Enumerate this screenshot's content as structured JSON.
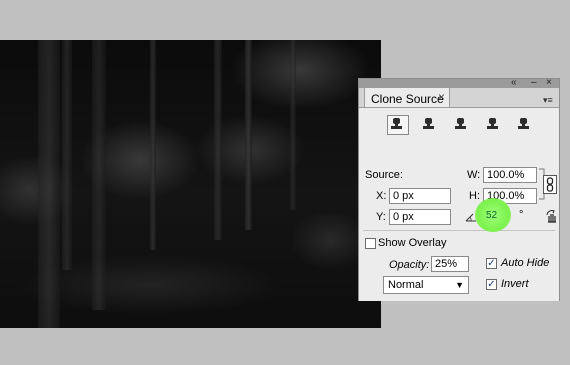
{
  "panel": {
    "tab_title": "Clone Source",
    "close_glyph": "×",
    "collapse_glyph": "«",
    "window_close_glyph": "×",
    "minimize_glyph": "–",
    "menu_glyph": "▾≡"
  },
  "source_buttons": [
    {
      "icon": "clone-source-icon",
      "active": true
    },
    {
      "icon": "clone-source-icon",
      "active": false
    },
    {
      "icon": "clone-source-icon",
      "active": false
    },
    {
      "icon": "clone-source-icon",
      "active": false
    },
    {
      "icon": "clone-source-icon",
      "active": false
    }
  ],
  "source": {
    "label": "Source:",
    "x_label": "X:",
    "x_value": "0 px",
    "y_label": "Y:",
    "y_value": "0 px",
    "w_label": "W:",
    "w_value": "100.0%",
    "h_label": "H:",
    "h_value": "100.0%",
    "rotation_value": "52",
    "degree_symbol": "°"
  },
  "overlay": {
    "show_label": "Show Overlay",
    "show_checked": false,
    "opacity_label": "Opacity:",
    "opacity_value": "25%",
    "auto_hide_label": "Auto Hide",
    "auto_hide_checked": true,
    "invert_label": "Invert",
    "invert_checked": true,
    "blend_mode": "Normal"
  },
  "colors": {
    "highlight": "#7df24f"
  }
}
